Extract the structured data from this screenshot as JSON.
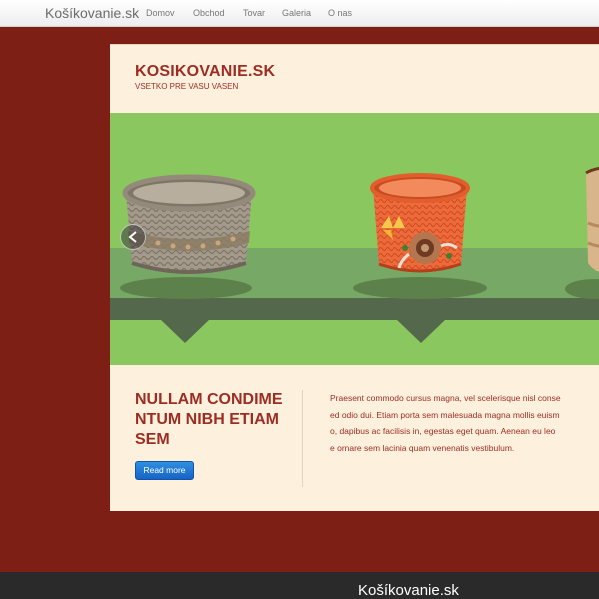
{
  "navbar": {
    "brand": "Košíkovanie.sk",
    "items": [
      {
        "label": "Domov"
      },
      {
        "label": "Obchod"
      },
      {
        "label": "Tovar"
      },
      {
        "label": "Galeria"
      },
      {
        "label": "O nas"
      }
    ]
  },
  "header": {
    "title": "KOSIKOVANIE.SK",
    "subtitle": "VSETKO PRE VASU VASEN"
  },
  "slider": {
    "prev_icon": "chevron-left-icon",
    "colors": {
      "background": "#8bc75f",
      "shelf": "#54684c"
    }
  },
  "content": {
    "heading_lines": [
      "NULLAM CONDIME",
      "NTUM NIBH ETIAM",
      "SEM"
    ],
    "read_more_label": "Read more",
    "paragraph_lines": [
      "Praesent commodo cursus magna, vel scelerisque nisl conse",
      "ed odio dui. Etiam porta sem malesuada magna mollis euism",
      "o, dapibus ac facilisis in, egestas eget quam. Aenean eu leo",
      "e ornare sem lacinia quam venenatis vestibulum."
    ]
  },
  "footer": {
    "brand": "Košíkovanie.sk"
  },
  "colors": {
    "page_background": "#7d1f15",
    "panel_background": "#fdf1dd",
    "accent_text": "#9c2d24",
    "button": "#1e74d0"
  }
}
